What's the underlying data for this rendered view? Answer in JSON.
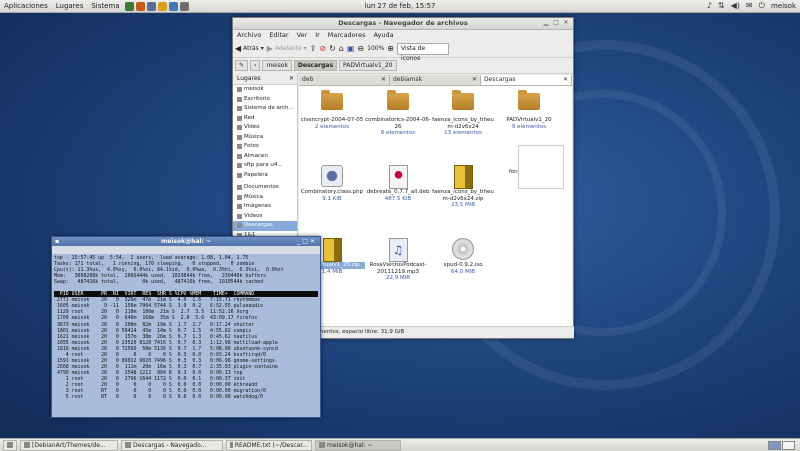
{
  "top_panel": {
    "menus": [
      "Aplicaciones",
      "Lugares",
      "Sistema"
    ],
    "clock": "lun 27 de feb, 15:57",
    "user": "meisok",
    "tray_icons": [
      "music-note-icon",
      "network-icon",
      "volume-icon",
      "mail-icon",
      "power-icon"
    ]
  },
  "file_manager": {
    "title": "Descargas - Navegador de archivos",
    "menu": [
      "Archivo",
      "Editar",
      "Ver",
      "Ir",
      "Marcadores",
      "Ayuda"
    ],
    "toolbar": {
      "back": "Atrás",
      "forward": "Adelante",
      "zoom": "100%",
      "view": "Vista de iconos"
    },
    "location": [
      "meisok",
      "Descargas",
      "PADVirtualv1_20"
    ],
    "sidebar": {
      "header": "Lugares",
      "items": [
        "meisok",
        "Escritorio",
        "Sistema de arch...",
        "Red",
        "Vídeo",
        "Música",
        "Fotos",
        "Almacen",
        "sftp para u4...",
        "Papelera",
        "Documentos",
        "Música",
        "Imágenes",
        "Vídeos",
        "Descargas",
        "1&1"
      ],
      "selected": 14
    },
    "tabs": [
      "deb",
      "debiamsk",
      "Descargas"
    ],
    "active_tab": 2,
    "files": [
      {
        "name": "clsencrypt-2004-07-05",
        "size": "2 elementos",
        "type": "folder"
      },
      {
        "name": "combinatorics-2004-06-26",
        "size": "6 elementos",
        "type": "folder"
      },
      {
        "name": "faenza_icons_by_tiheum-d2v6x24",
        "size": "13 elementos",
        "type": "folder"
      },
      {
        "name": "PADVirtualv1_20",
        "size": "9 elementos",
        "type": "folder"
      },
      {
        "name": "Combinatory.class.php",
        "size": "9,1 KiB",
        "type": "php"
      },
      {
        "name": "debreate_0.7.7_all.deb",
        "size": "487,5 KiB",
        "type": "deb"
      },
      {
        "name": "faenza_icons_by_tiheum-d2v6x24.zip",
        "size": "23,5 MiB",
        "type": "zip"
      },
      {
        "name": "fontstarter.svg",
        "size": "7,8 KiB",
        "type": "svg"
      },
      {
        "name": "PADVirtualv1_20.zip",
        "size": "1,4 MiB",
        "type": "zip",
        "selected": true
      },
      {
        "name": "RosaVientosPodcast-20111219.mp3",
        "size": "22,9 MiB",
        "type": "mp3"
      },
      {
        "name": "xpud-0.9.2.iso",
        "size": "64,0 MiB",
        "type": "iso"
      }
    ],
    "status": "11 elementos, espacio libre: 31,9 GiB"
  },
  "terminal": {
    "title": "meisok@hal: ~",
    "summary": [
      "top - 15:57:45 up  5:54,  2 users,  load average: 1.08, 1.04, 1.75",
      "Tasks: 171 total,   1 running, 170 sleeping,   0 stopped,   0 zombie",
      "Cpu(s): 11.3%us,  4.0%sy,  0.0%ni, 84.1%id,  0.0%wa,  0.3%hi,  0.3%si,  0.0%st",
      "Mem:   3098208k total,  2066444k used,  1029844k free,   230440k buffers",
      "Swap:   487416k total,        0k used,   487416k free,  1010544k cached"
    ],
    "header": "  PID USER      PR  NI  VIRT  RES  SHR S %CPU %MEM    TIME+  COMMAND",
    "rows": [
      " 2771 meisok    20   0  326m  47m  21m S  4.0  1.6   7:15.71 rhythmbox",
      " 1605 meisok     9 -11  156m 7004 5744 S  3.0  0.2   6:52.55 pulseaudio",
      " 1129 root      20   0  110m  106m  21m S  2.7  3.5  11:52.16 Xorg",
      " 1709 meisok    20   0  646m  168m  35m S  2.0  5.6  43:09.17 firefox",
      " 3673 meisok    20   0  200m  82m  19m S  1.7  2.7   0:17.24 shutter",
      " 1801 meisok    20   0 59424  45m  14m S  0.7  1.5   4:55.02 compiz",
      " 1621 meisok    20   0  157m  38m  26m S  0.7  1.3   0:45.62 nautilus",
      " 1655 meisok    20   0 23520 8128 7416 S  0.7  0.3   1:12.98 multiload-apple",
      " 1818 meisok    20   0 72560  50m 5136 S  0.7  1.7   5:08.06 ubuntuone-syncd",
      "    4 root      20   0     0    0    0 S  0.3  0.0   0:03.24 ksoftirqd/0",
      " 1591 meisok    20   0 89012 9020 7496 S  0.3  0.3   0:06.96 gnome-settings-",
      " 2668 meisok    20   0  111m  20m  16m S  0.3  0.7   2:35.93 plugin-containe",
      " 4790 meisok    20   0  2548 1212  904 R  0.3  0.0   0:00.13 top",
      "    1 root      20   0  2796 1644 1172 S  0.0  0.1   0:00.37 init",
      "    2 root      20   0     0    0    0 S  0.0  0.0   0:00.00 kthreadd",
      "    3 root      RT   0     0    0    0 S  0.0  0.0   0:00.00 migration/0",
      "    5 root      RT   0     0    0    0 S  0.0  0.0   0:00.00 watchdog/0"
    ]
  },
  "taskbar": [
    {
      "label": "[DebianArt/Themes/de...",
      "active": false
    },
    {
      "label": "Descargas - Navegado...",
      "active": false
    },
    {
      "label": "README.txt (~/Descar...",
      "active": false
    },
    {
      "label": "meisok@hal: ~",
      "active": true
    }
  ]
}
